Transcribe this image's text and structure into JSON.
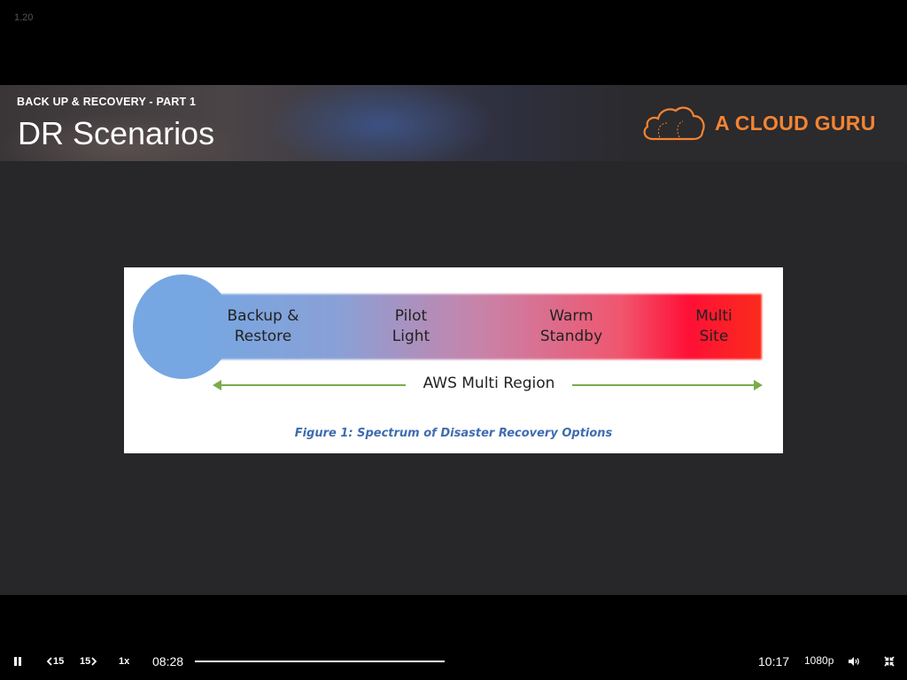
{
  "version": "1.20",
  "slide": {
    "subtitle": "BACK UP & RECOVERY - PART 1",
    "title": "DR Scenarios",
    "brand": "A CLOUD GURU",
    "brand_color": "#f58431"
  },
  "figure": {
    "labels": [
      {
        "line1": "Backup &",
        "line2": "Restore"
      },
      {
        "line1": "Pilot",
        "line2": "Light"
      },
      {
        "line1": "Warm",
        "line2": "Standby"
      },
      {
        "line1": "Multi",
        "line2": "Site"
      }
    ],
    "region_label": "AWS Multi Region",
    "caption": "Figure 1:  Spectrum of Disaster Recovery Options"
  },
  "player": {
    "pause_icon": "pause-icon",
    "rewind_label": "15",
    "forward_label": "15",
    "speed": "1x",
    "current_time": "08:28",
    "duration": "10:17",
    "quality": "1080p",
    "progress": 0.824
  }
}
